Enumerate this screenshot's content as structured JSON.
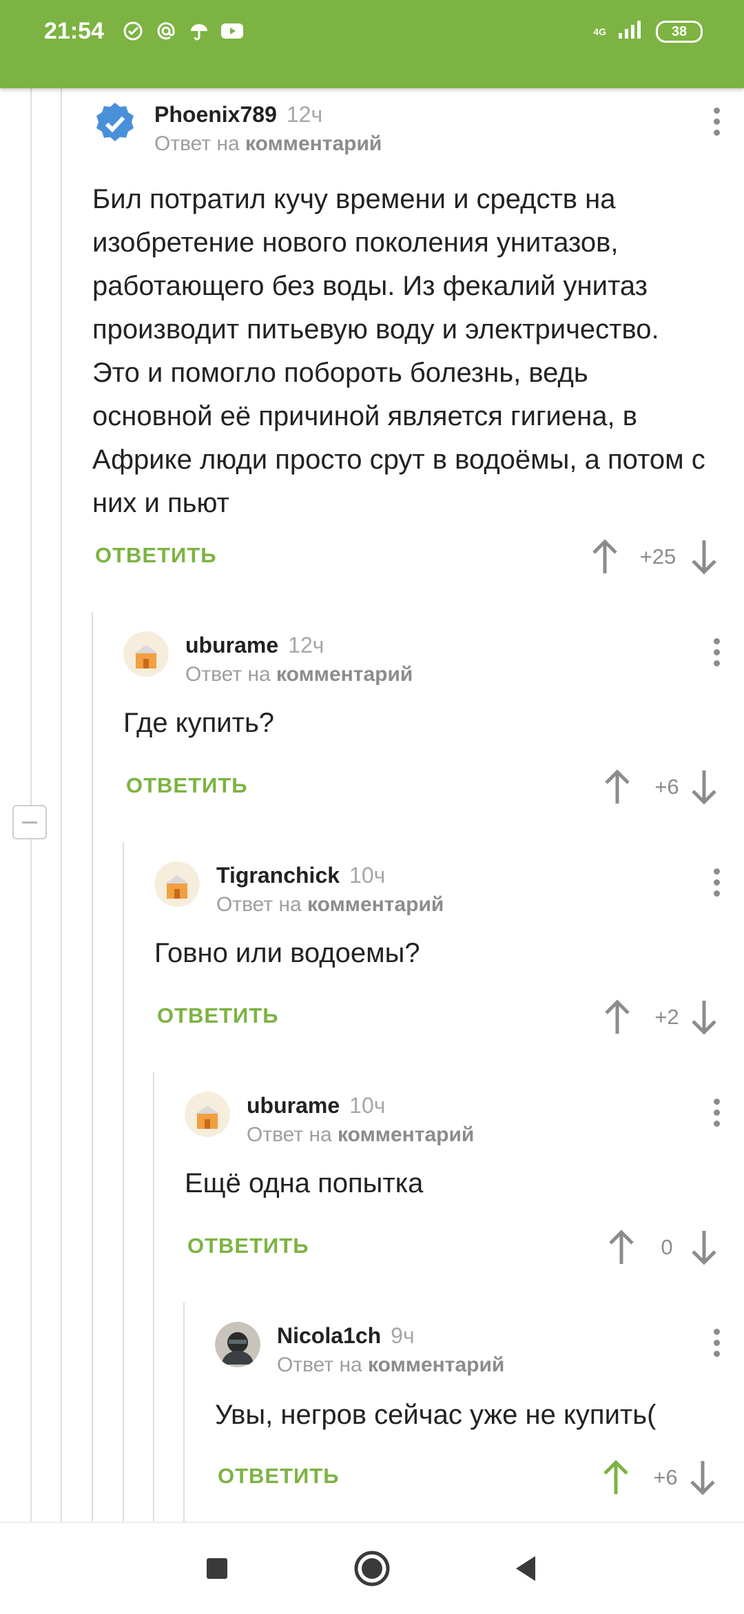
{
  "status_bar": {
    "time": "21:54",
    "network": "4G",
    "battery": "38",
    "icons": [
      "sber-icon",
      "at-icon",
      "umbrella-icon",
      "youtube-icon"
    ]
  },
  "colors": {
    "accent": "#7cb342",
    "upvote_active": "#7cb342",
    "muted": "#9e9e9e"
  },
  "reply_label": "ОТВЕТИТЬ",
  "comments": [
    {
      "author": "Phoenix789",
      "time": "12ч",
      "reply_prefix": "Ответ на",
      "reply_target": "комментарий",
      "text": "Бил потратил кучу времени и средств на изобретение нового поколения унитазов, работающего без воды. Из фекалий унитаз производит питьевую воду и электричество. Это и помогло побороть болезнь, ведь основной её причиной является гигиена, в Африке люди просто срут в водоёмы, а потом с них и пьют",
      "score": "+25",
      "avatar": "verified-badge-icon"
    },
    {
      "author": "uburame",
      "time": "12ч",
      "reply_prefix": "Ответ на",
      "reply_target": "комментарий",
      "text": "Где купить?",
      "score": "+6",
      "avatar": "default-avatar"
    },
    {
      "author": "Tigranchick",
      "time": "10ч",
      "reply_prefix": "Ответ на",
      "reply_target": "комментарий",
      "text": "Говно или водоемы?",
      "score": "+2",
      "avatar": "default-avatar"
    },
    {
      "author": "uburame",
      "time": "10ч",
      "reply_prefix": "Ответ на",
      "reply_target": "комментарий",
      "text": "Ещё одна попытка",
      "score": "0",
      "avatar": "default-avatar"
    },
    {
      "author": "Nicola1ch",
      "time": "9ч",
      "reply_prefix": "Ответ на",
      "reply_target": "комментарий",
      "text": "Увы, негров сейчас уже не купить(",
      "score": "+6",
      "avatar": "photo-avatar",
      "upvoted": true
    }
  ]
}
